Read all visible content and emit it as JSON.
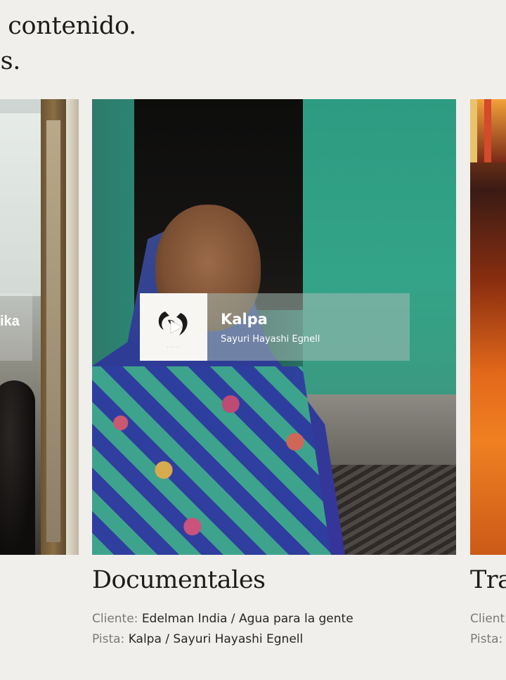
{
  "headline": {
    "line1": "e contenido.",
    "line2": "as."
  },
  "cards": {
    "left": {
      "overlay_title": "ika"
    },
    "center": {
      "overlay_title": "Kalpa",
      "overlay_artist": "Sayuri Hayashi Egnell",
      "category": "Documentales",
      "client_label": "Cliente:",
      "client_value": "Edelman India / Agua para la gente",
      "track_label": "Pista:",
      "track_value": "Kalpa / Sayuri Hayashi Egnell"
    },
    "right": {
      "category": "Tra",
      "client_label": "Client",
      "track_label": "Pista:"
    }
  },
  "icons": {
    "play": "play-icon"
  }
}
